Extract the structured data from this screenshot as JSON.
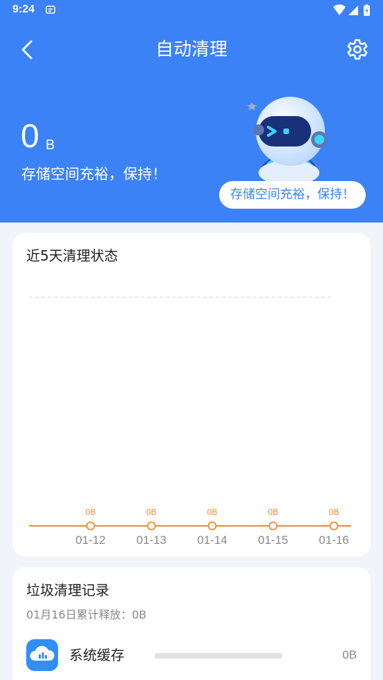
{
  "status_bar": {
    "time": "9:24"
  },
  "header": {
    "title": "自动清理",
    "back_icon": "chevron-left-icon",
    "settings_icon": "gear-icon",
    "size_value": "0",
    "size_unit": "B",
    "status_message": "存储空间充裕，保持！",
    "bubble_text": "存储空间充裕，保持！",
    "accent_color": "#3b82f6"
  },
  "chart_card": {
    "title": "近5天清理状态"
  },
  "chart_data": {
    "type": "line",
    "categories": [
      "01-12",
      "01-13",
      "01-14",
      "01-15",
      "01-16"
    ],
    "values": [
      0,
      0,
      0,
      0,
      0
    ],
    "data_labels": [
      "0B",
      "0B",
      "0B",
      "0B",
      "0B"
    ],
    "title": "近5天清理状态",
    "line_color": "#ef8a2a"
  },
  "records_card": {
    "title": "垃圾清理记录",
    "subtitle": "01月16日累计释放：0B",
    "items": [
      {
        "name": "系统缓存",
        "value": "0B",
        "fraction": 0,
        "icon": "cloud-chart-icon"
      }
    ]
  }
}
